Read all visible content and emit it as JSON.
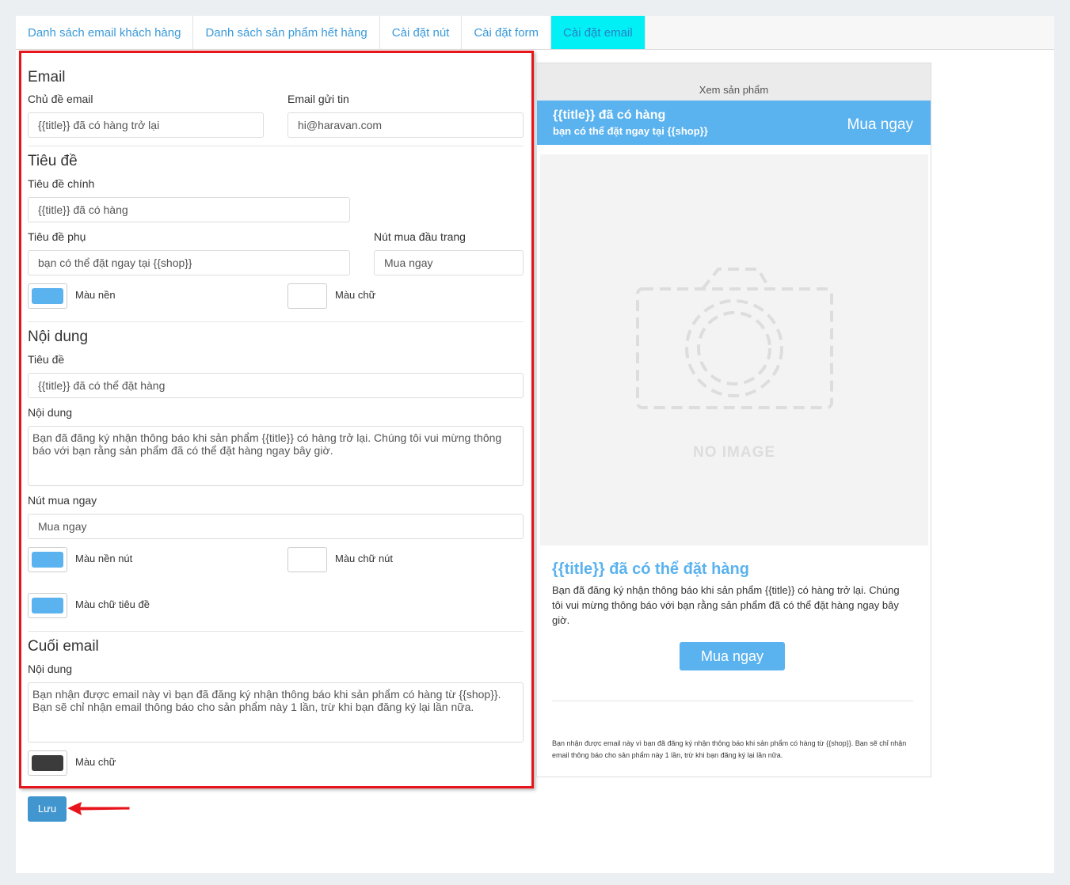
{
  "tabs": [
    {
      "label": "Danh sách email khách hàng"
    },
    {
      "label": "Danh sách sản phẩm hết hàng"
    },
    {
      "label": "Cài đặt nút"
    },
    {
      "label": "Cài đặt form"
    },
    {
      "label": "Cài đặt email",
      "active": true
    }
  ],
  "email": {
    "heading": "Email",
    "subject_label": "Chủ đề email",
    "subject_value": "{{title}} đã có hàng trở lại",
    "sender_label": "Email gửi tin",
    "sender_value": "hi@haravan.com"
  },
  "header": {
    "heading": "Tiêu đề",
    "main_label": "Tiêu đề chính",
    "main_value": "{{title}} đã có hàng",
    "sub_label": "Tiêu đề phụ",
    "sub_value": "bạn có thể đặt ngay tại {{shop}}",
    "buy_label": "Nút mua đầu trang",
    "buy_value": "Mua ngay",
    "bg_label": "Màu nền",
    "text_label": "Màu chữ"
  },
  "content": {
    "heading": "Nội dung",
    "title_label": "Tiêu đề",
    "title_value": "{{title}} đã có thể đặt hàng",
    "body_label": "Nội dung",
    "body_value": "Bạn đã đăng ký nhận thông báo khi sản phẩm {{title}} có hàng trở lại. Chúng tôi vui mừng thông báo với bạn rằng sản phẩm đã có thể đặt hàng ngay bây giờ.",
    "button_label": "Nút mua ngay",
    "button_value": "Mua ngay",
    "btn_bg_label": "Màu nền nút",
    "btn_text_label": "Màu chữ nút",
    "title_color_label": "Màu chữ tiêu đề"
  },
  "footer": {
    "heading": "Cuối email",
    "body_label": "Nội dung",
    "body_value": "Bạn nhận được email này vì bạn đã đăng ký nhận thông báo khi sản phẩm có hàng từ {{shop}}. Bạn sẽ chỉ nhận email thông báo cho sản phẩm này 1 lần, trừ khi bạn đăng ký lại lần nữa.",
    "text_color_label": "Màu chữ"
  },
  "colors": {
    "accent": "#5ab2ef",
    "white": "#ffffff",
    "footer_text": "#3b3b3b"
  },
  "preview": {
    "view_product": "Xem sản phẩm",
    "banner_title": "{{title}} đã có hàng",
    "banner_sub": "bạn có thể đặt ngay tại {{shop}}",
    "banner_button": "Mua ngay",
    "no_image": "NO IMAGE",
    "title": "{{title}} đã có thể đặt hàng",
    "body": "Bạn đã đăng ký nhận thông báo khi sản phẩm {{title}} có hàng trở lại. Chúng tôi vui mừng thông báo với bạn rằng sản phẩm đã có thể đặt hàng ngay bây giờ.",
    "button": "Mua ngay",
    "footer": "Bạn nhận được email này vì bạn đã đăng ký nhận thông báo khi sản phẩm có hàng từ {{shop}}. Bạn sẽ chỉ nhận email thông báo cho sản phẩm này 1 lần, trừ khi bạn đăng ký lại lần nữa."
  },
  "save_label": "Lưu"
}
